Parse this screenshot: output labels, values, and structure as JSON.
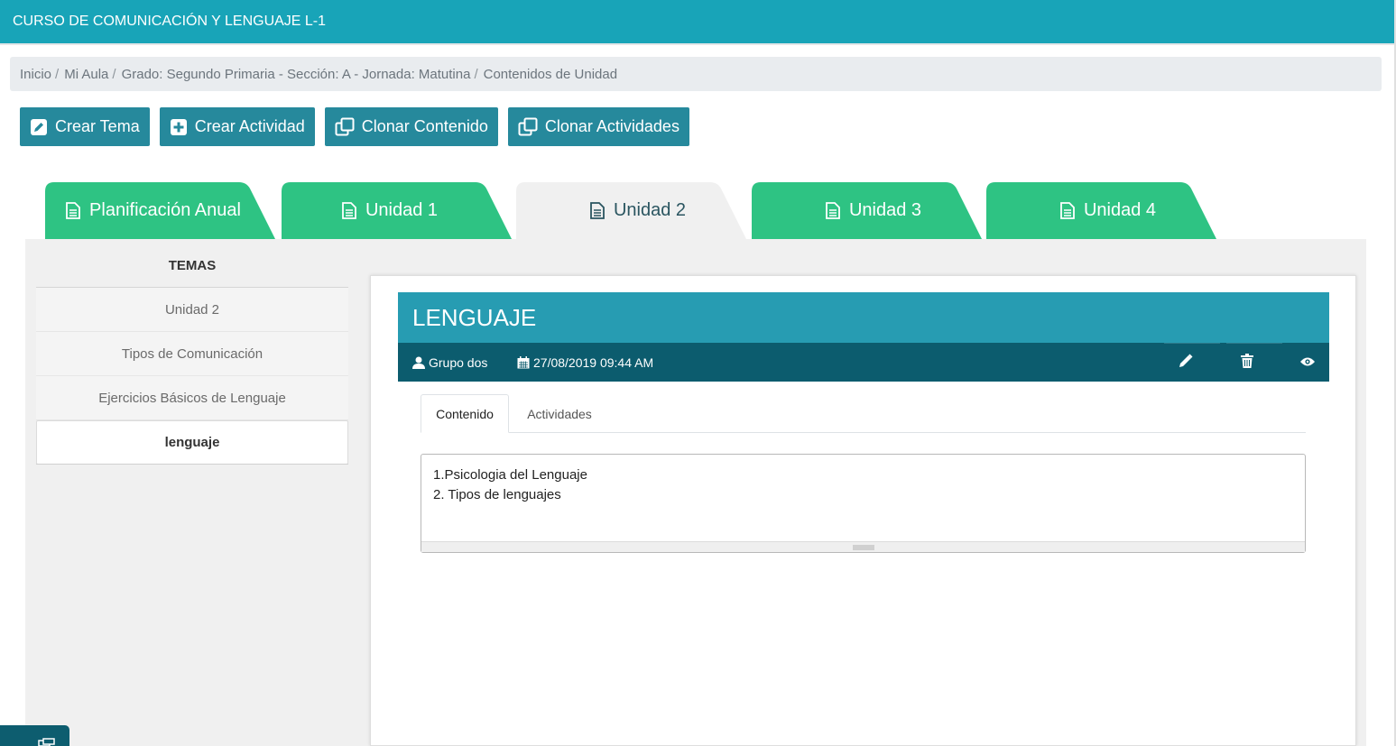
{
  "header": {
    "title": "CURSO DE COMUNICACIÓN Y LENGUAJE L-1"
  },
  "breadcrumb": [
    {
      "label": "Inicio"
    },
    {
      "label": "Mi Aula"
    },
    {
      "label": "Grado: Segundo Primaria - Sección: A - Jornada: Matutina"
    },
    {
      "label": "Contenidos de Unidad"
    }
  ],
  "breadcrumb_separator": "/",
  "toolbar": {
    "crear_tema": {
      "label": "Crear Tema",
      "icon": "pencil-square-icon"
    },
    "crear_actividad": {
      "label": "Crear Actividad",
      "icon": "plus-square-icon"
    },
    "clonar_contenido": {
      "label": "Clonar Contenido",
      "icon": "clone-icon"
    },
    "clonar_actividades": {
      "label": "Clonar Actividades",
      "icon": "clone-icon"
    }
  },
  "unit_tabs": [
    {
      "label": "Planificación Anual",
      "active": false
    },
    {
      "label": "Unidad 1",
      "active": false
    },
    {
      "label": "Unidad 2",
      "active": true
    },
    {
      "label": "Unidad 3",
      "active": false
    },
    {
      "label": "Unidad 4",
      "active": false
    }
  ],
  "temas": {
    "title": "TEMAS",
    "items": [
      {
        "label": "Unidad 2",
        "active": false
      },
      {
        "label": "Tipos de Comunicación",
        "active": false
      },
      {
        "label": "Ejercicios Básicos de Lenguaje",
        "active": false
      },
      {
        "label": "lenguaje",
        "active": true
      }
    ]
  },
  "topic": {
    "title": "LENGUAJE",
    "group": "Grupo dos",
    "datetime": "27/08/2019 09:44 AM",
    "actions": [
      "edit-icon",
      "trash-icon",
      "eye-icon"
    ]
  },
  "content_tabs": [
    {
      "label": "Contenido",
      "active": true
    },
    {
      "label": "Actividades",
      "active": false
    }
  ],
  "editor": {
    "lines": [
      "1.Psicologia del Lenguaje",
      "2. Tipos de lenguajes"
    ]
  },
  "colors": {
    "header_bg": "#18a4b8",
    "button_bg": "#26899c",
    "tab_green": "#2ec383",
    "tab_active": "#f0f0f0",
    "topic_head": "#279cb2",
    "topic_meta": "#0c5c6e"
  }
}
